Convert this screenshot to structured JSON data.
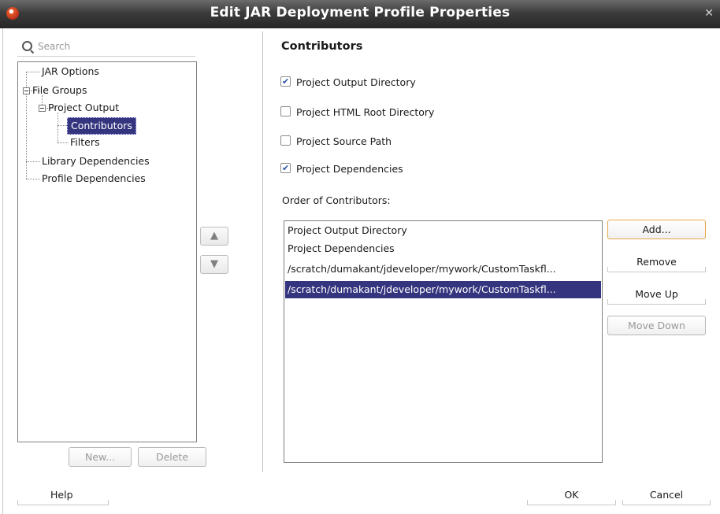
{
  "window": {
    "title": "Edit JAR Deployment Profile Properties"
  },
  "search": {
    "placeholder": "Search"
  },
  "tree": {
    "items": [
      {
        "label": "JAR Options"
      },
      {
        "label": "File Groups"
      },
      {
        "label": "Project Output"
      },
      {
        "label": "Contributors"
      },
      {
        "label": "Filters"
      },
      {
        "label": "Library Dependencies"
      },
      {
        "label": "Profile Dependencies"
      }
    ],
    "selected": "Contributors"
  },
  "tree_buttons": {
    "new": "New...",
    "delete": "Delete"
  },
  "panel": {
    "heading": "Contributors",
    "checkboxes": [
      {
        "label": "Project Output Directory",
        "checked": true
      },
      {
        "label": "Project HTML Root Directory",
        "checked": false
      },
      {
        "label": "Project Source Path",
        "checked": false
      },
      {
        "label": "Project Dependencies",
        "checked": true
      }
    ],
    "order_label": "Order of Contributors:",
    "contributors": [
      "Project Output Directory",
      "Project Dependencies",
      "/scratch/dumakant/jdeveloper/mywork/CustomTaskfl...",
      "/scratch/dumakant/jdeveloper/mywork/CustomTaskfl..."
    ],
    "selected_index": 3,
    "buttons": {
      "add": "Add...",
      "remove": "Remove",
      "move_up": "Move Up",
      "move_down": "Move Down"
    }
  },
  "footer": {
    "help": "Help",
    "ok": "OK",
    "cancel": "Cancel"
  },
  "icons": {
    "app": "jdeveloper-app-icon",
    "up": "arrow-up-icon",
    "down": "arrow-down-icon",
    "search": "search-icon",
    "close": "close-icon"
  },
  "colors": {
    "selection": "#35357f",
    "titlebar": "#3c3c3c",
    "focus_border": "#e8a64a"
  }
}
